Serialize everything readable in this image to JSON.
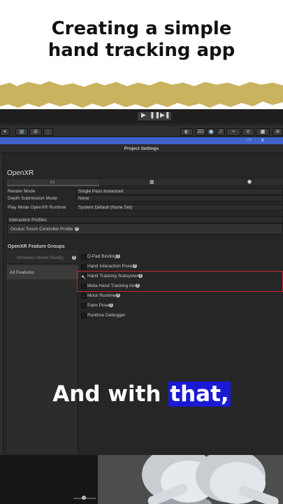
{
  "header": {
    "line1": "Creating a simple",
    "line2": "hand tracking app"
  },
  "colors": {
    "accent_gold": "#c9b35e",
    "highlight_blue": "#1a1ad4",
    "selection_red": "#c0282e"
  },
  "toolbar": {
    "play_icon": "play-icon",
    "pause_icon": "pause-icon",
    "step_icon": "step-icon",
    "view_2d": "2D"
  },
  "window": {
    "title": "Project Settings",
    "close": "x"
  },
  "openxr": {
    "heading": "OpenXR",
    "platform_tabs": [
      "desktop-icon",
      "android-icon",
      "web-icon"
    ],
    "settings": [
      {
        "label": "Render Mode",
        "value": "Single Pass Instanced"
      },
      {
        "label": "Depth Submission Mode",
        "value": "None"
      },
      {
        "label": "Play Mode OpenXR Runtime",
        "value": "System Default (None Set)"
      }
    ],
    "interaction_profiles_label": "Interaction Profiles",
    "interaction_profile": "Oculus Touch Controller Profile",
    "feature_groups_label": "OpenXR Feature Groups",
    "groups": [
      "Windows Mixed Reality",
      "All Features"
    ],
    "features": [
      {
        "label": "D-Pad Binding",
        "checked": false
      },
      {
        "label": "Hand Interaction Poses",
        "checked": false
      },
      {
        "label": "Hand Tracking Subsystem",
        "checked": false
      },
      {
        "label": "Meta Hand Tracking Aim",
        "checked": false
      },
      {
        "label": "Mock Runtime",
        "checked": false
      },
      {
        "label": "Palm Pose",
        "checked": false
      },
      {
        "label": "Runtime Debugger",
        "checked": false
      }
    ]
  },
  "caption": {
    "text": "And with",
    "highlight": "that,"
  }
}
